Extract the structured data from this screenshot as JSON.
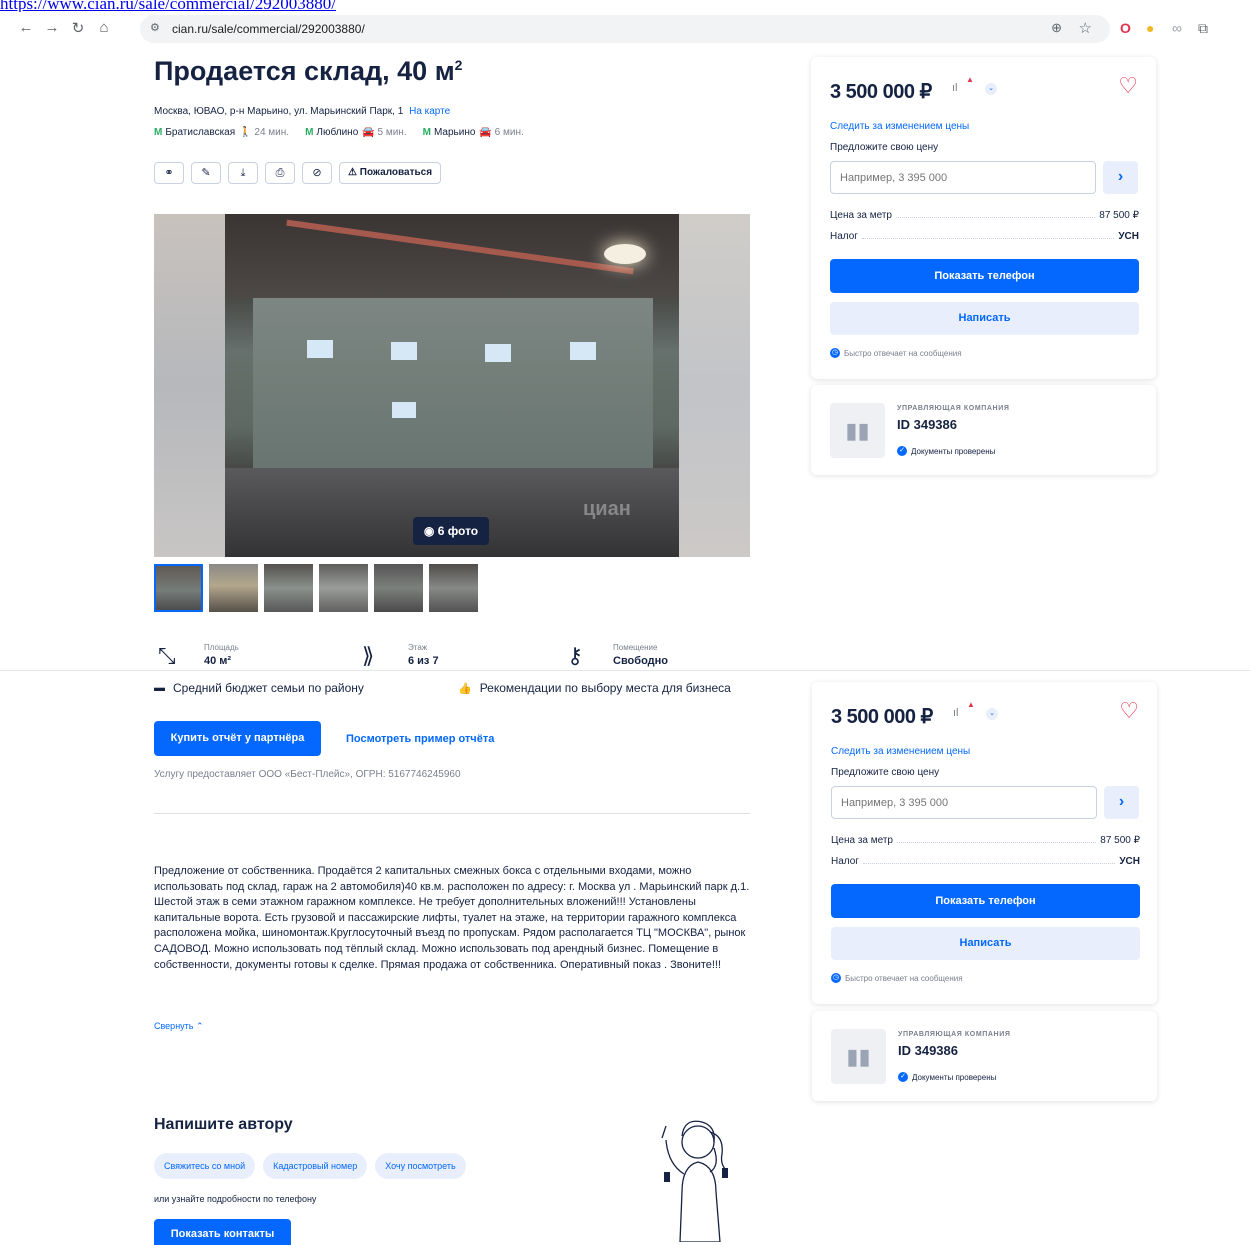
{
  "top_link": "https://www.cian.ru/sale/commercial/292003880/",
  "browser": {
    "url": "cian.ru/sale/commercial/292003880/",
    "back_icon": "arrow-left-icon",
    "forward_icon": "arrow-right-icon",
    "reload_icon": "reload-icon",
    "home_icon": "home-icon"
  },
  "listing": {
    "title": "Продается склад, 40 м",
    "title_sup": "2",
    "address": "Москва, ЮВАО, р-н Марьино, ул. Марьинский Парк, 1",
    "map_link": "На карте",
    "metro": [
      {
        "name": "Братиславская",
        "mode": "walk",
        "time": "24 мин."
      },
      {
        "name": "Люблино",
        "mode": "car",
        "time": "5 мин."
      },
      {
        "name": "Марьино",
        "mode": "car",
        "time": "6 мин."
      }
    ],
    "tools": {
      "complain": "Пожаловаться"
    },
    "photo_count": "6 фото",
    "watermark": "циан"
  },
  "features": [
    {
      "label": "Площадь",
      "value": "40 м²"
    },
    {
      "label": "Этаж",
      "value": "6 из 7"
    },
    {
      "label": "Помещение",
      "value": "Свободно"
    }
  ],
  "report": {
    "item1": "Средний бюджет семьи по району",
    "item2": "Рекомендации по выбору места для бизнеса",
    "buy_button": "Купить отчёт у партнёра",
    "sample_link": "Посмотреть пример отчёта",
    "provider": "Услугу предоставляет ООО «Бест-Плейс», ОГРН: 5167746245960"
  },
  "description": "Предложение от собственника. Продаётся 2 капитальных смежных бокса с отдельными входами, можно использовать под склад, гараж на 2 автомобиля)40 кв.м. расположен по адресу: г. Москва ул . Марьинский парк д.1. Шестой этаж в семи этажном гаражном комплексе. Не требует дополнительных вложений!!! Установлены капитальные ворота. Есть грузовой и пассажирские лифты, туалет на этаже, на территории гаражного комплекса расположена мойка, шиномонтаж.Круглосуточный въезд по пропускам.  Рядом располагается ТЦ \"МОСКВА\", рынок САДОВОД. Можно использовать под тёплый склад. Можно использовать под арендный бизнес. Помещение в собственности, документы готовы к сделке. Прямая продажа от собственника. Оперативный показ . Звоните!!!",
  "collapse": "Свернуть",
  "contact": {
    "title": "Напишите автору",
    "chips": [
      "Свяжитесь со мной",
      "Кадастровый номер",
      "Хочу посмотреть"
    ],
    "phone_note": "или узнайте подробности по телефону",
    "show_contacts": "Показать контакты"
  },
  "price_card": {
    "price": "3 500 000 ₽",
    "follow": "Следить за изменением цены",
    "offer_label": "Предложите свою цену",
    "offer_placeholder": "Например, 3 395 000",
    "price_per_meter_label": "Цена за метр",
    "price_per_meter": "87 500 ₽",
    "tax_label": "Налог",
    "tax": "УСН",
    "show_phone": "Показать телефон",
    "write": "Написать",
    "fast_reply": "Быстро отвечает на сообщения"
  },
  "agent_card": {
    "role": "УПРАВЛЯЮЩАЯ КОМПАНИЯ",
    "id": "ID 349386",
    "verified": "Документы проверены"
  },
  "colors": {
    "accent": "#0468ff",
    "text": "#152242",
    "heart": "#e0344b",
    "metro": "#27ae60"
  }
}
